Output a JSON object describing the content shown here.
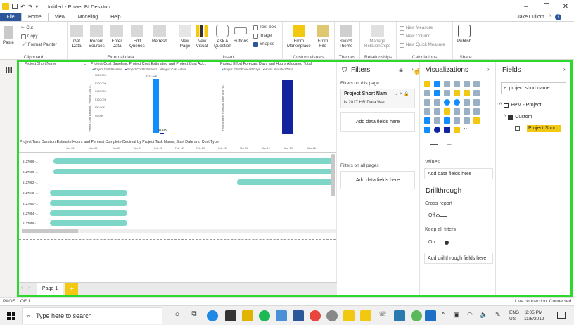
{
  "app": {
    "title": "Untitled - Power BI Desktop",
    "user": "Jake Cullom",
    "tabs": [
      "File",
      "Home",
      "View",
      "Modeling",
      "Help"
    ]
  },
  "ribbon": {
    "clipboard": {
      "paste": "Paste",
      "cut": "Cut",
      "copy": "Copy",
      "format_painter": "Format Painter",
      "label": "Clipboard"
    },
    "external_data": {
      "get_data": "Get\nData",
      "recent_sources": "Recent\nSources",
      "enter_data": "Enter\nData",
      "edit_queries": "Edit\nQueries",
      "refresh": "Refresh",
      "label": "External data"
    },
    "insert": {
      "new_page": "New\nPage",
      "new_visual": "New\nVisual",
      "ask_question": "Ask A\nQuestion",
      "buttons": "Buttons",
      "text_box": "Text box",
      "image": "Image",
      "shapes": "Shapes",
      "label": "Insert"
    },
    "custom_visuals": {
      "from_marketplace": "From\nMarketplace",
      "from_file": "From\nFile",
      "label": "Custom visuals"
    },
    "themes": {
      "switch_theme": "Switch\nTheme",
      "label": "Themes"
    },
    "relationships": {
      "manage": "Manage\nRelationships",
      "label": "Relationships"
    },
    "calculations": {
      "new_measure": "New Measure",
      "new_column": "New Column",
      "new_quick_measure": "New Quick Measure",
      "label": "Calculations"
    },
    "share": {
      "publish": "Publish",
      "label": "Share"
    }
  },
  "canvas": {
    "slicer_title": "Project Short Name",
    "chart1": {
      "title": "Project Cost Baseline, Project Cost Estimated and Project Cost Act...",
      "legend": [
        "Project Cost Baseline",
        "Project Cost Estimated",
        "Project Cost Actual"
      ],
      "ylabel": "Project Cost Baseline, Project Cost E...",
      "yticks": [
        "$250.00K",
        "$200.00K",
        "$150.00K",
        "$100.00K",
        "$50.00K",
        "$0.00K"
      ],
      "data_labels": [
        "$223.94K",
        "$3.44K"
      ]
    },
    "chart2": {
      "title": "Project Effort Forecast Days and Hours Allocated Total",
      "legend": [
        "Project Effort Forecast Days",
        "Hours Allocated Total"
      ],
      "ylabel": "Project Effort Forecast Days and Ho..."
    },
    "gantt": {
      "title": "Project Task Duration Estimate Hours and Percent Complete Decimal by Project Task Name, Start Date and Cost Type",
      "dates": [
        "Jan 08",
        "Jan 15",
        "Jan 22",
        "Jan 29",
        "Feb 05",
        "Feb 12",
        "Feb 19",
        "Feb 26",
        "Mar 05",
        "Mar 12",
        "Mar 19",
        "Mar 26"
      ],
      "rows": [
        "5127066 -...",
        "5127060 -...",
        "5127062 -...",
        "5127048 -...",
        "5127050 -...",
        "5127054 -...",
        "5127056 -..."
      ]
    },
    "page_tab": "Page 1",
    "add_page": "+"
  },
  "filters": {
    "title": "Filters",
    "on_this_page": "Filters on this page",
    "filter_card_title": "Project Short Nam",
    "filter_card_value": "is 2017 HR Data War...",
    "add_fields_here": "Add data fields here",
    "on_all_pages": "Filters on all pages",
    "add_fields_here_all": "Add data fields here"
  },
  "visualizations": {
    "title": "Visualizations",
    "values_label": "Values",
    "values_drop": "Add data fields here",
    "drillthrough": "Drillthrough",
    "cross_report": "Cross-report",
    "cross_report_state": "Off",
    "keep_all_filters": "Keep all filters",
    "keep_all_filters_state": "On",
    "drillthrough_drop": "Add drillthrough fields here"
  },
  "fields": {
    "title": "Fields",
    "search_value": "project short name",
    "tables": [
      {
        "name": "PPM - Project",
        "expanded": false
      },
      {
        "name": "Custom",
        "expanded": true,
        "fields": [
          "Project Shor..."
        ]
      }
    ]
  },
  "status": {
    "page": "PAGE 1 OF 1",
    "connection": "Live connection: Connected"
  },
  "taskbar": {
    "search_placeholder": "Type here to search",
    "lang": "ENG",
    "region": "US",
    "time": "2:05 PM",
    "date": "11/6/2019"
  },
  "colors": {
    "accent_green": "#2ed92e",
    "file_tab": "#2b579a",
    "bar_blue": "#118dff",
    "bar_navy": "#12239e",
    "bar_orange": "#e66c37",
    "gantt_teal": "#7dd6c8",
    "highlight_yellow": "#f2c811"
  }
}
